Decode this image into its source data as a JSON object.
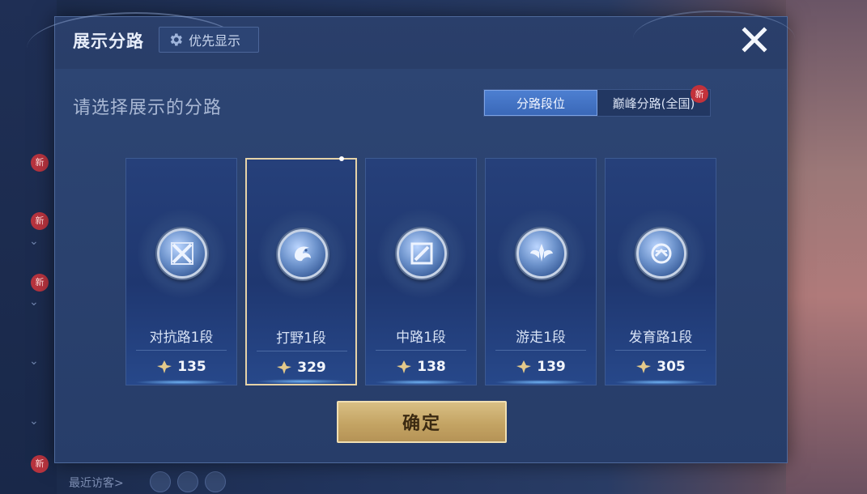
{
  "dialog": {
    "title": "展示分路",
    "priority_label": "优先显示",
    "subtitle": "请选择展示的分路",
    "tabs": [
      {
        "label": "分路段位",
        "active": true
      },
      {
        "label": "巅峰分路(全国)",
        "active": false,
        "badge": "新"
      }
    ],
    "cards": [
      {
        "label": "对抗路1段",
        "score": "135",
        "icon": "crossed-swords-icon",
        "selected": false
      },
      {
        "label": "打野1段",
        "score": "329",
        "icon": "dragon-icon",
        "selected": true
      },
      {
        "label": "中路1段",
        "score": "138",
        "icon": "slash-square-icon",
        "selected": false
      },
      {
        "label": "游走1段",
        "score": "139",
        "icon": "wings-icon",
        "selected": false
      },
      {
        "label": "发育路1段",
        "score": "305",
        "icon": "arrows-icon",
        "selected": false
      }
    ],
    "confirm_label": "确定"
  },
  "background": {
    "bottom_text": "最近访客>",
    "new_badge": "新",
    "accent_gold": "#c4a464",
    "accent_blue": "#3a68b8"
  }
}
